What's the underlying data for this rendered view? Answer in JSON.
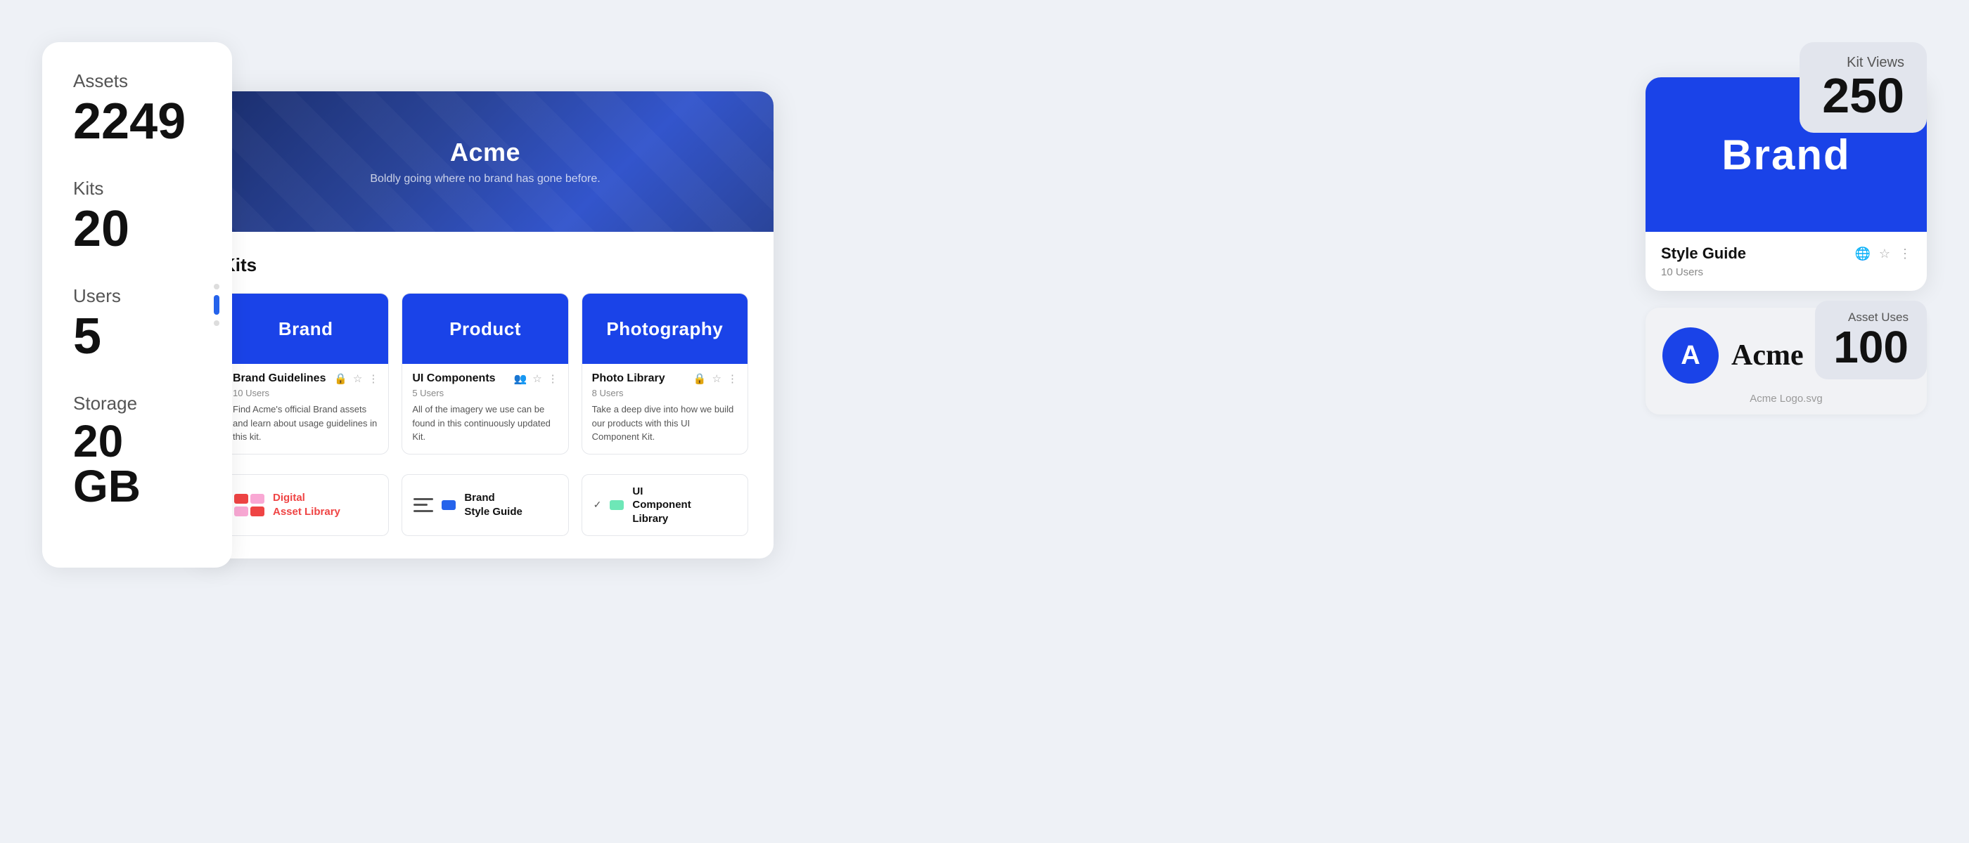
{
  "stats": {
    "assets_label": "Assets",
    "assets_value": "2249",
    "kits_label": "Kits",
    "kits_value": "20",
    "users_label": "Users",
    "users_value": "5",
    "storage_label": "Storage",
    "storage_value": "20 GB"
  },
  "hero": {
    "title": "Acme",
    "subtitle": "Boldly going where no brand has gone before."
  },
  "kits_section": {
    "heading": "Kits",
    "kits": [
      {
        "thumb_label": "Brand",
        "name": "Brand Guidelines",
        "users": "10 Users",
        "description": "Find Acme's official Brand assets and learn about usage guidelines in this kit."
      },
      {
        "thumb_label": "Product",
        "name": "UI Components",
        "users": "5 Users",
        "description": "All of the imagery we use can be found in this continuously updated Kit."
      },
      {
        "thumb_label": "Photography",
        "name": "Photo Library",
        "users": "8 Users",
        "description": "Take a deep dive into how we build our products with this UI Component Kit."
      }
    ],
    "bottom_kits": [
      {
        "label": "Digital\nAsset Library",
        "type": "red"
      },
      {
        "label": "Brand\nStyle Guide",
        "type": "blue"
      },
      {
        "label": "UI\nComponent\nLibrary",
        "type": "green"
      }
    ]
  },
  "right_panel": {
    "kit_views_label": "Kit Views",
    "kit_views_value": "250",
    "style_guide": {
      "thumb_label": "Brand",
      "name": "Style Guide",
      "users": "10 Users"
    },
    "asset_uses_label": "Asset Uses",
    "asset_uses_value": "100",
    "acme_logo": {
      "avatar_letter": "A",
      "name": "Acme",
      "filename": "Acme Logo.svg"
    }
  }
}
